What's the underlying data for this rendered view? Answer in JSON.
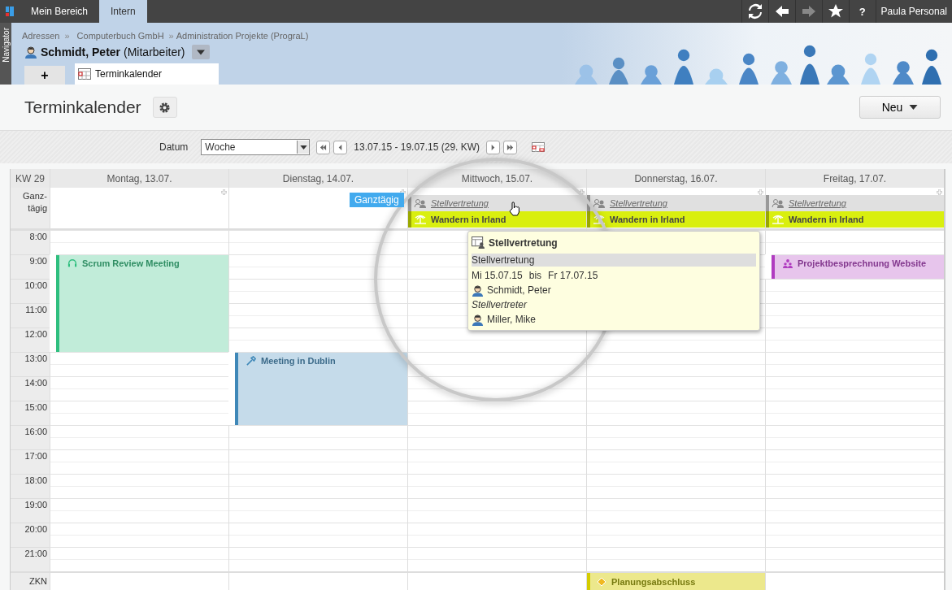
{
  "top_bar": {
    "tabs": [
      {
        "label": "Mein Bereich",
        "selected": false
      },
      {
        "label": "Intern",
        "selected": true
      }
    ],
    "forward_disabled": true,
    "help": "?",
    "user": "Paula Personal"
  },
  "navigator": {
    "label": "Navigator"
  },
  "breadcrumb": [
    {
      "kind": "link",
      "text": "Adressen"
    },
    {
      "kind": "separator",
      "text": "»"
    },
    {
      "kind": "company",
      "text": "Computerbuch GmbH"
    },
    {
      "kind": "separator",
      "text": "»"
    },
    {
      "kind": "link",
      "text": "Administration Projekte (PrograL)"
    }
  ],
  "record": {
    "name": "Schmidt, Peter",
    "role": "(Mitarbeiter)"
  },
  "page_tabs": {
    "add": "+",
    "tabs": [
      {
        "label": "Terminkalender",
        "selected": true
      }
    ]
  },
  "page": {
    "title": "Terminkalender",
    "new_button": "Neu"
  },
  "toolbar": {
    "label": "Datum",
    "view": "Woche",
    "range": "13.07.15 - 19.07.15 (29. KW)"
  },
  "calendar": {
    "week": "KW 29",
    "allday_label": "Ganz-\ntägig",
    "zkn_label": "ZKN",
    "hours": [
      "8:00",
      "9:00",
      "10:00",
      "11:00",
      "12:00",
      "13:00",
      "14:00",
      "15:00",
      "16:00",
      "17:00",
      "18:00",
      "19:00",
      "20:00",
      "21:00"
    ],
    "days": [
      {
        "label": "Montag, 13.07.",
        "slots": [
          {
            "busy": false
          },
          {
            "busy": true,
            "event": {
              "kind": "call",
              "title": "Scrum Review Meeting",
              "color": "#2fbf7f"
            }
          },
          {
            "busy": true
          },
          {
            "busy": true
          },
          {
            "busy": true
          },
          {
            "busy": false
          },
          {
            "busy": false
          },
          {
            "busy": false
          },
          {
            "busy": false
          },
          {
            "busy": false
          },
          {
            "busy": false
          },
          {
            "busy": false
          },
          {
            "busy": false
          },
          {
            "busy": false
          }
        ]
      },
      {
        "label": "Dienstag, 14.07.",
        "slots": [
          {
            "busy": false
          },
          {
            "busy": false
          },
          {
            "busy": false
          },
          {
            "busy": false
          },
          {
            "busy": false
          },
          {
            "busy": true,
            "event": {
              "kind": "trip",
              "title": "Meeting in Dublin",
              "color": "#3f88b8"
            }
          },
          {
            "busy": true
          },
          {
            "busy": true
          },
          {
            "busy": false
          },
          {
            "busy": false
          },
          {
            "busy": false
          },
          {
            "busy": false
          },
          {
            "busy": false
          },
          {
            "busy": false
          }
        ]
      },
      {
        "label": "Mittwoch, 15.07.",
        "allday": [
          {
            "kind": "absence",
            "title": "Stellvertretung"
          },
          {
            "kind": "holiday",
            "title": "Wandern in Irland"
          }
        ]
      },
      {
        "label": "Donnerstag, 16.07.",
        "allday": [
          {
            "kind": "absence",
            "title": "Stellvertretung"
          },
          {
            "kind": "holiday",
            "title": "Wandern in Irland"
          }
        ],
        "zkn": [
          {
            "kind": "milestone",
            "title": "Planungsabschluss",
            "color": "#d4cc00"
          }
        ]
      },
      {
        "label": "Freitag, 17.07.",
        "allday": [
          {
            "kind": "absence",
            "title": "Stellvertretung"
          },
          {
            "kind": "holiday",
            "title": "Wandern in Irland"
          }
        ],
        "slots": [
          {
            "busy": false
          },
          {
            "busy": true,
            "event": {
              "kind": "meeting",
              "title": "Projektbesprechnung Website",
              "color": "#b03cc0"
            }
          },
          {
            "busy": false
          },
          {
            "busy": false
          },
          {
            "busy": false
          },
          {
            "busy": false
          },
          {
            "busy": false
          },
          {
            "busy": false
          },
          {
            "busy": false
          },
          {
            "busy": false
          },
          {
            "busy": false
          },
          {
            "busy": false
          },
          {
            "busy": false
          },
          {
            "busy": false
          }
        ]
      }
    ]
  },
  "hover_label": "Ganztägig",
  "tooltip": {
    "title": "Stellvertretung",
    "subject": "Stellvertretung",
    "from": "Mi 15.07.15",
    "bis": "bis",
    "to": "Fr 17.07.15",
    "person": "Schmidt, Peter",
    "role_label": "Stellvertreter",
    "substitute": "Miller, Mike"
  }
}
